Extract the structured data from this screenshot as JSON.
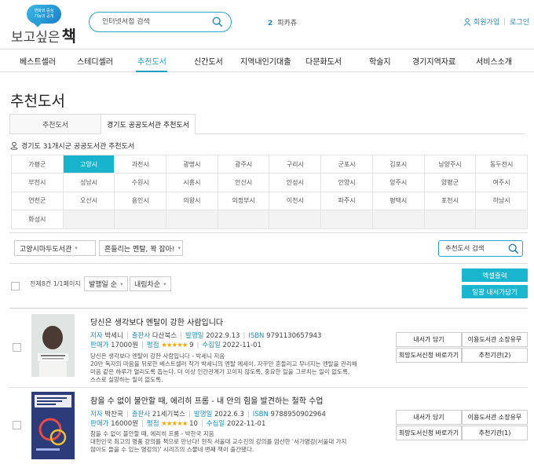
{
  "header": {
    "logo_bubble_line1": "변화의 중심",
    "logo_bubble_line2": "가능의 공개",
    "logo_text": "보고싶은",
    "logo_bold": "책",
    "search_placeholder": "인터넷서점 검색",
    "rank_number": "2",
    "rank_text": "피카츄",
    "signup": "회원가입",
    "login": "로그인"
  },
  "nav": [
    {
      "label": "베스트셀러"
    },
    {
      "label": "스테디셀러"
    },
    {
      "label": "추천도서",
      "active": true
    },
    {
      "label": "신간도서"
    },
    {
      "label": "지역내인기대출"
    },
    {
      "label": "다문화도서"
    },
    {
      "label": "학술지"
    },
    {
      "label": "경기지역자료"
    },
    {
      "label": "서비스소개"
    }
  ],
  "page_title": "추천도서",
  "tabs": [
    "추천도서",
    "경기도 공공도서관 추천도서"
  ],
  "region_label": "경기도 31개시군 공공도서관 추천도서",
  "cities": [
    "가평군",
    "고양시",
    "과천시",
    "광명시",
    "광주시",
    "구리시",
    "군포시",
    "김포시",
    "남양주시",
    "동두천시",
    "부천시",
    "성남시",
    "수원시",
    "시흥시",
    "안산시",
    "안성시",
    "안양시",
    "양주시",
    "양평군",
    "여주시",
    "연천군",
    "오산시",
    "용인시",
    "의왕시",
    "의정부시",
    "이천시",
    "파주시",
    "평택시",
    "포천시",
    "하남시",
    "화성시"
  ],
  "active_city": "고양시",
  "filters": {
    "library": "고양시마두도서관",
    "theme": "흔들리는 멘탈, 꽉 잡아!",
    "search_placeholder": "추천도서 검색"
  },
  "list_controls": {
    "count": "전체8건 1/1페이지",
    "sort": "발행일 순",
    "order": "내림차순",
    "excel": "엑셀출력",
    "add_all": "일괄 내서가담기"
  },
  "labels": {
    "author": "저자",
    "publisher": "출판사",
    "pubdate": "발행일",
    "isbn": "ISBN",
    "price": "판매가",
    "rating": "평점",
    "collected": "수집일"
  },
  "books": [
    {
      "title": "당신은 생각보다 멘탈이 강한 사람입니다",
      "author": "박세니",
      "publisher": "다산북스",
      "pubdate": "2022.9.13",
      "isbn": "9791130657943",
      "price": "17000원",
      "stars": "★★★★★",
      "score": "9",
      "collected": "2022-11-01",
      "desc_line1": "당신은 생각보다 멘탈이 강한 사람입니다 - 박세니 지음",
      "desc_line2": "20만 독자의 마음을 뒤로한 베스트셀러 작가 박세니의 멘탈 에세이. 자꾸만 흔들리고 무너지는 멘탈을 관리해",
      "desc_line3": "마음 같은 하루가 열리도록 돕는다. 더 이상 인간관계가 꼬이지 않도록, 중요한 일을 그르치는 일이 없도록,",
      "desc_line4": "스스로 실망하는 일이 없도록.",
      "btn_shelf": "내서가 담기",
      "btn_hold": "이용도서관 소장유무",
      "btn_request": "희망도서신청 바로가기",
      "btn_recommend": "추천기관(2)"
    },
    {
      "title": "참을 수 없이 불안할 때, 에리히 프롬 - 내 안의 힘을 발견하는 철학 수업",
      "author": "박찬국",
      "publisher": "21세기북스",
      "pubdate": "2022.6.3",
      "isbn": "9788950902964",
      "price": "16000원",
      "stars": "★★★★★",
      "score": "10",
      "collected": "2022-11-01",
      "desc_line1": "참을 수 없이 불안할 때, 에리히 프롬 - 박찬국 지음",
      "desc_line2": "대한민국 최고의 명품 강의를 책으로 만난다! 현직 서울대 교수진의 강의를 엄선한 '서가명강(서울대 가지",
      "desc_line3": "않아도 들을 수 있는 명강의)' 시리즈의 스물네 번째 책이 출간됐다.",
      "desc_line4": "",
      "btn_shelf": "내서가 담기",
      "btn_hold": "이용도서관 소장유무",
      "btn_request": "희망도서신청 바로가기",
      "btn_recommend": "추천기관(1)"
    }
  ],
  "colors": {
    "accent": "#1ab5cf",
    "link": "#1a8fc0",
    "star": "#f2a900"
  }
}
